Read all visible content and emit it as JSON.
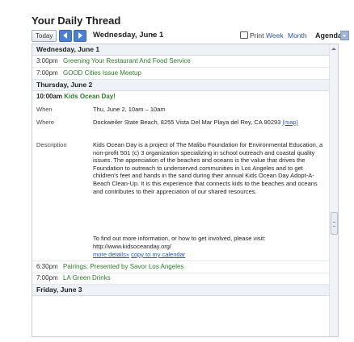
{
  "title": "Your Daily Thread",
  "toolbar": {
    "today_label": "Today",
    "prev_icon": "arrow-left-icon",
    "next_icon": "arrow-right-icon",
    "date_label": "Wednesday, June 1",
    "date_caret": "▾",
    "print_label": "Print",
    "week_label": "Week",
    "month_label": "Month",
    "agenda_label": "Agenda"
  },
  "colors": {
    "accent": "#4a7fd1",
    "event_text": "#2d7a2d",
    "link": "#2a55a8",
    "header_bg": "#eef1f6"
  },
  "agenda": {
    "day1": {
      "heading": "Wednesday, June 1",
      "events": [
        {
          "time": "3:00pm",
          "title": "Greening Your Restaurant And Food Service"
        },
        {
          "time": "7:00pm",
          "title": "GOOD Cities Issue Meetup"
        }
      ]
    },
    "day2": {
      "heading": "Thursday, June 2",
      "expanded": {
        "time": "10:00am",
        "title": "Kids Ocean Day!",
        "when_label": "When",
        "when_value": "Thu, June 2, 10am – 10am",
        "where_label": "Where",
        "where_value": "Dockweiler State Beach, 8255 Vista Del Mar Playa del Rey, CA 90293",
        "map_link": "(map)",
        "description_label": "Description",
        "description": "Kids Ocean Day is a project of The Malibu Foundation for Environmental Education, a non-profit 501 (c) 3 organization specializing in school outreach and coastal quality issues. The appreciation of the beaches and oceans is the value that drives the Foundation to outreach to underserved communities in Los Angeles and to get children's feet and hands in the sand during their annual Kids Ocean Day Adopt-A-Beach Clean-Up. It is this experience that connects kids to the beaches and oceans and contributes to their appreciation of our shared resources.",
        "more_info": "To find out more information, or how to get involved, please visit:",
        "url": "http://www.kidsoceanday.org/",
        "more_details": "more details»",
        "copy_link": "copy to my calendar"
      },
      "events": [
        {
          "time": "6:30pm",
          "title": "Pairings: Presented by Savor Los Angeles"
        },
        {
          "time": "7:00pm",
          "title": "LA Green Drinks"
        }
      ]
    },
    "day3": {
      "heading": "Friday, June 3"
    }
  }
}
